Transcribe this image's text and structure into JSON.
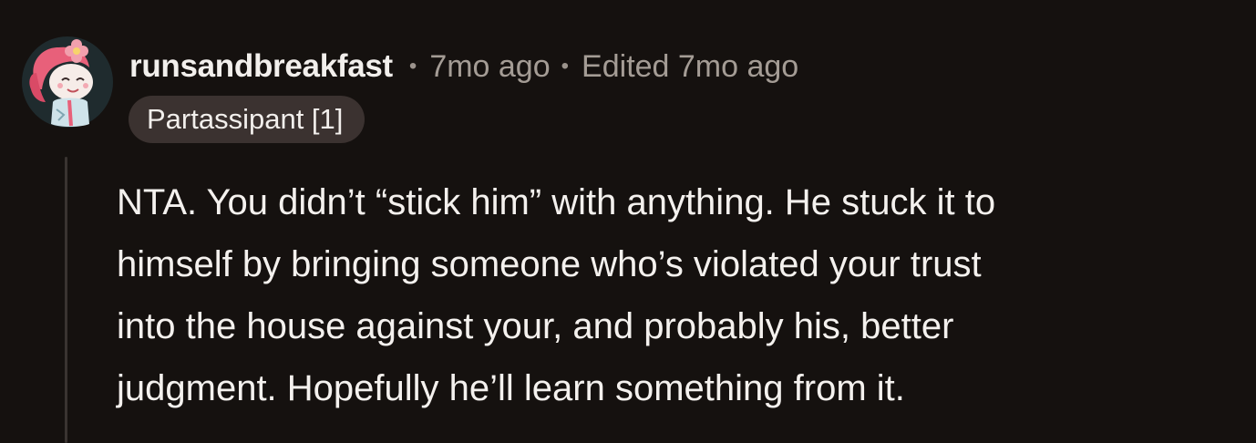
{
  "comment": {
    "username": "runsandbreakfast",
    "separator": "•",
    "posted": "7mo ago",
    "edited": "Edited 7mo ago",
    "flair": "Partassipant [1]",
    "lines": [
      "NTA. You didn’t “stick him” with anything. He stuck it to",
      "himself by bringing someone who’s violated your trust",
      "into the house against your, and probably his, better",
      "judgment. Hopefully he’ll learn something from it."
    ]
  },
  "colors": {
    "background": "#15110f",
    "flair_bg": "#3b3230",
    "meta_text": "#a49c95",
    "body_text": "#f4f1ee",
    "avatar_hair": "#e8607a"
  },
  "icons": {
    "avatar": "snoo-avatar-with-pink-hair-and-flower"
  }
}
